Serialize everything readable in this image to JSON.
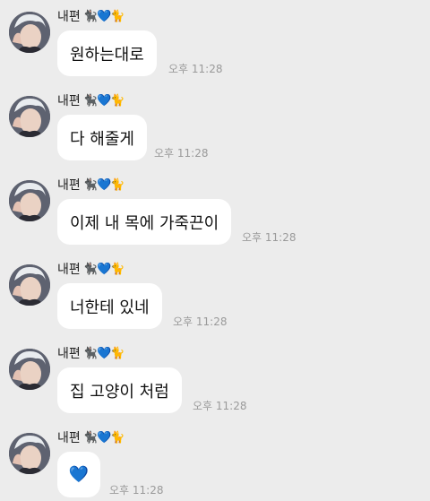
{
  "sender": {
    "name": "내편",
    "emoji": "🐈‍⬛💙🐈"
  },
  "messages": [
    {
      "text": "원하는대로",
      "time": "오후 11:28"
    },
    {
      "text": "다 해줄게",
      "time": "오후 11:28"
    },
    {
      "text": "이제 내 목에 가죽끈이",
      "time": "오후 11:28"
    },
    {
      "text": "너한테 있네",
      "time": "오후 11:28"
    },
    {
      "text": "집 고양이 처럼",
      "time": "오후 11:28"
    },
    {
      "text": "💙",
      "time": "오후 11:28"
    }
  ],
  "colors": {
    "background": "#ececec",
    "bubble": "#ffffff",
    "time": "#9a9a9a"
  }
}
